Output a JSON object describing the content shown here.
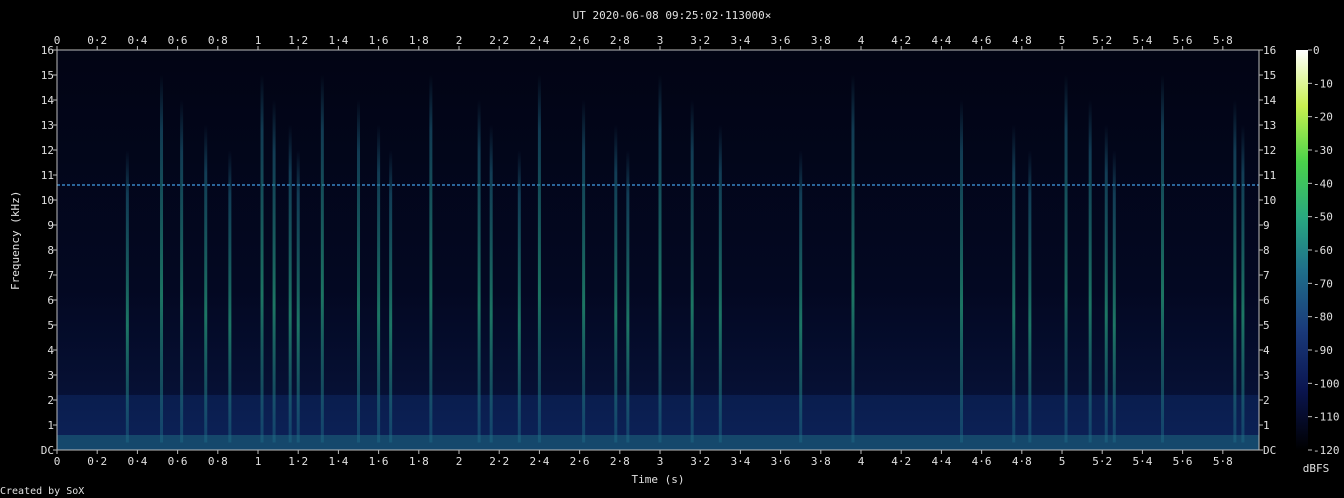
{
  "chart_data": {
    "type": "heatmap",
    "title": "UT 2020-06-08 09:25:02·113000×",
    "xlabel": "Time (s)",
    "ylabel": "Frequency (kHz)",
    "xlim": [
      0,
      5.98
    ],
    "ylim": [
      0,
      16
    ],
    "x_ticks": [
      "0",
      "0·2",
      "0·4",
      "0·6",
      "0·8",
      "1",
      "1·2",
      "1·4",
      "1·6",
      "1·8",
      "2",
      "2·2",
      "2·4",
      "2·6",
      "2·8",
      "3",
      "3·2",
      "3·4",
      "3·6",
      "3·8",
      "4",
      "4·2",
      "4·4",
      "4·6",
      "4·8",
      "5",
      "5·2",
      "5·4",
      "5·6",
      "5·8"
    ],
    "y_ticks": [
      "DC",
      "1",
      "2",
      "3",
      "4",
      "5",
      "6",
      "7",
      "8",
      "9",
      "10",
      "11",
      "12",
      "13",
      "14",
      "15",
      "16"
    ],
    "colorbar": {
      "label": "dBFS",
      "range": [
        -120,
        0
      ],
      "ticks": [
        "0",
        "-10",
        "-20",
        "-30",
        "-40",
        "-50",
        "-60",
        "-70",
        "-80",
        "-90",
        "-100",
        "-110",
        "-120"
      ]
    },
    "colormap_colors": [
      "#000000",
      "#0a1550",
      "#1a3a7a",
      "#1f6f8a",
      "#28a880",
      "#4ad24a",
      "#c8f050",
      "#ffffff"
    ],
    "features": {
      "noise_floor_band_khz": [
        0,
        0.6
      ],
      "horizontal_line_khz": 10.6,
      "vertical_transients_s": [
        0.35,
        0.52,
        0.62,
        0.74,
        0.86,
        1.02,
        1.08,
        1.16,
        1.2,
        1.32,
        1.5,
        1.6,
        1.66,
        1.86,
        2.1,
        2.16,
        2.3,
        2.4,
        2.62,
        2.78,
        2.84,
        3.0,
        3.16,
        3.3,
        3.7,
        3.96,
        4.5,
        4.76,
        4.84,
        5.02,
        5.14,
        5.22,
        5.26,
        5.5,
        5.86,
        5.9
      ]
    }
  },
  "footer": {
    "credit": "Created by SoX"
  }
}
